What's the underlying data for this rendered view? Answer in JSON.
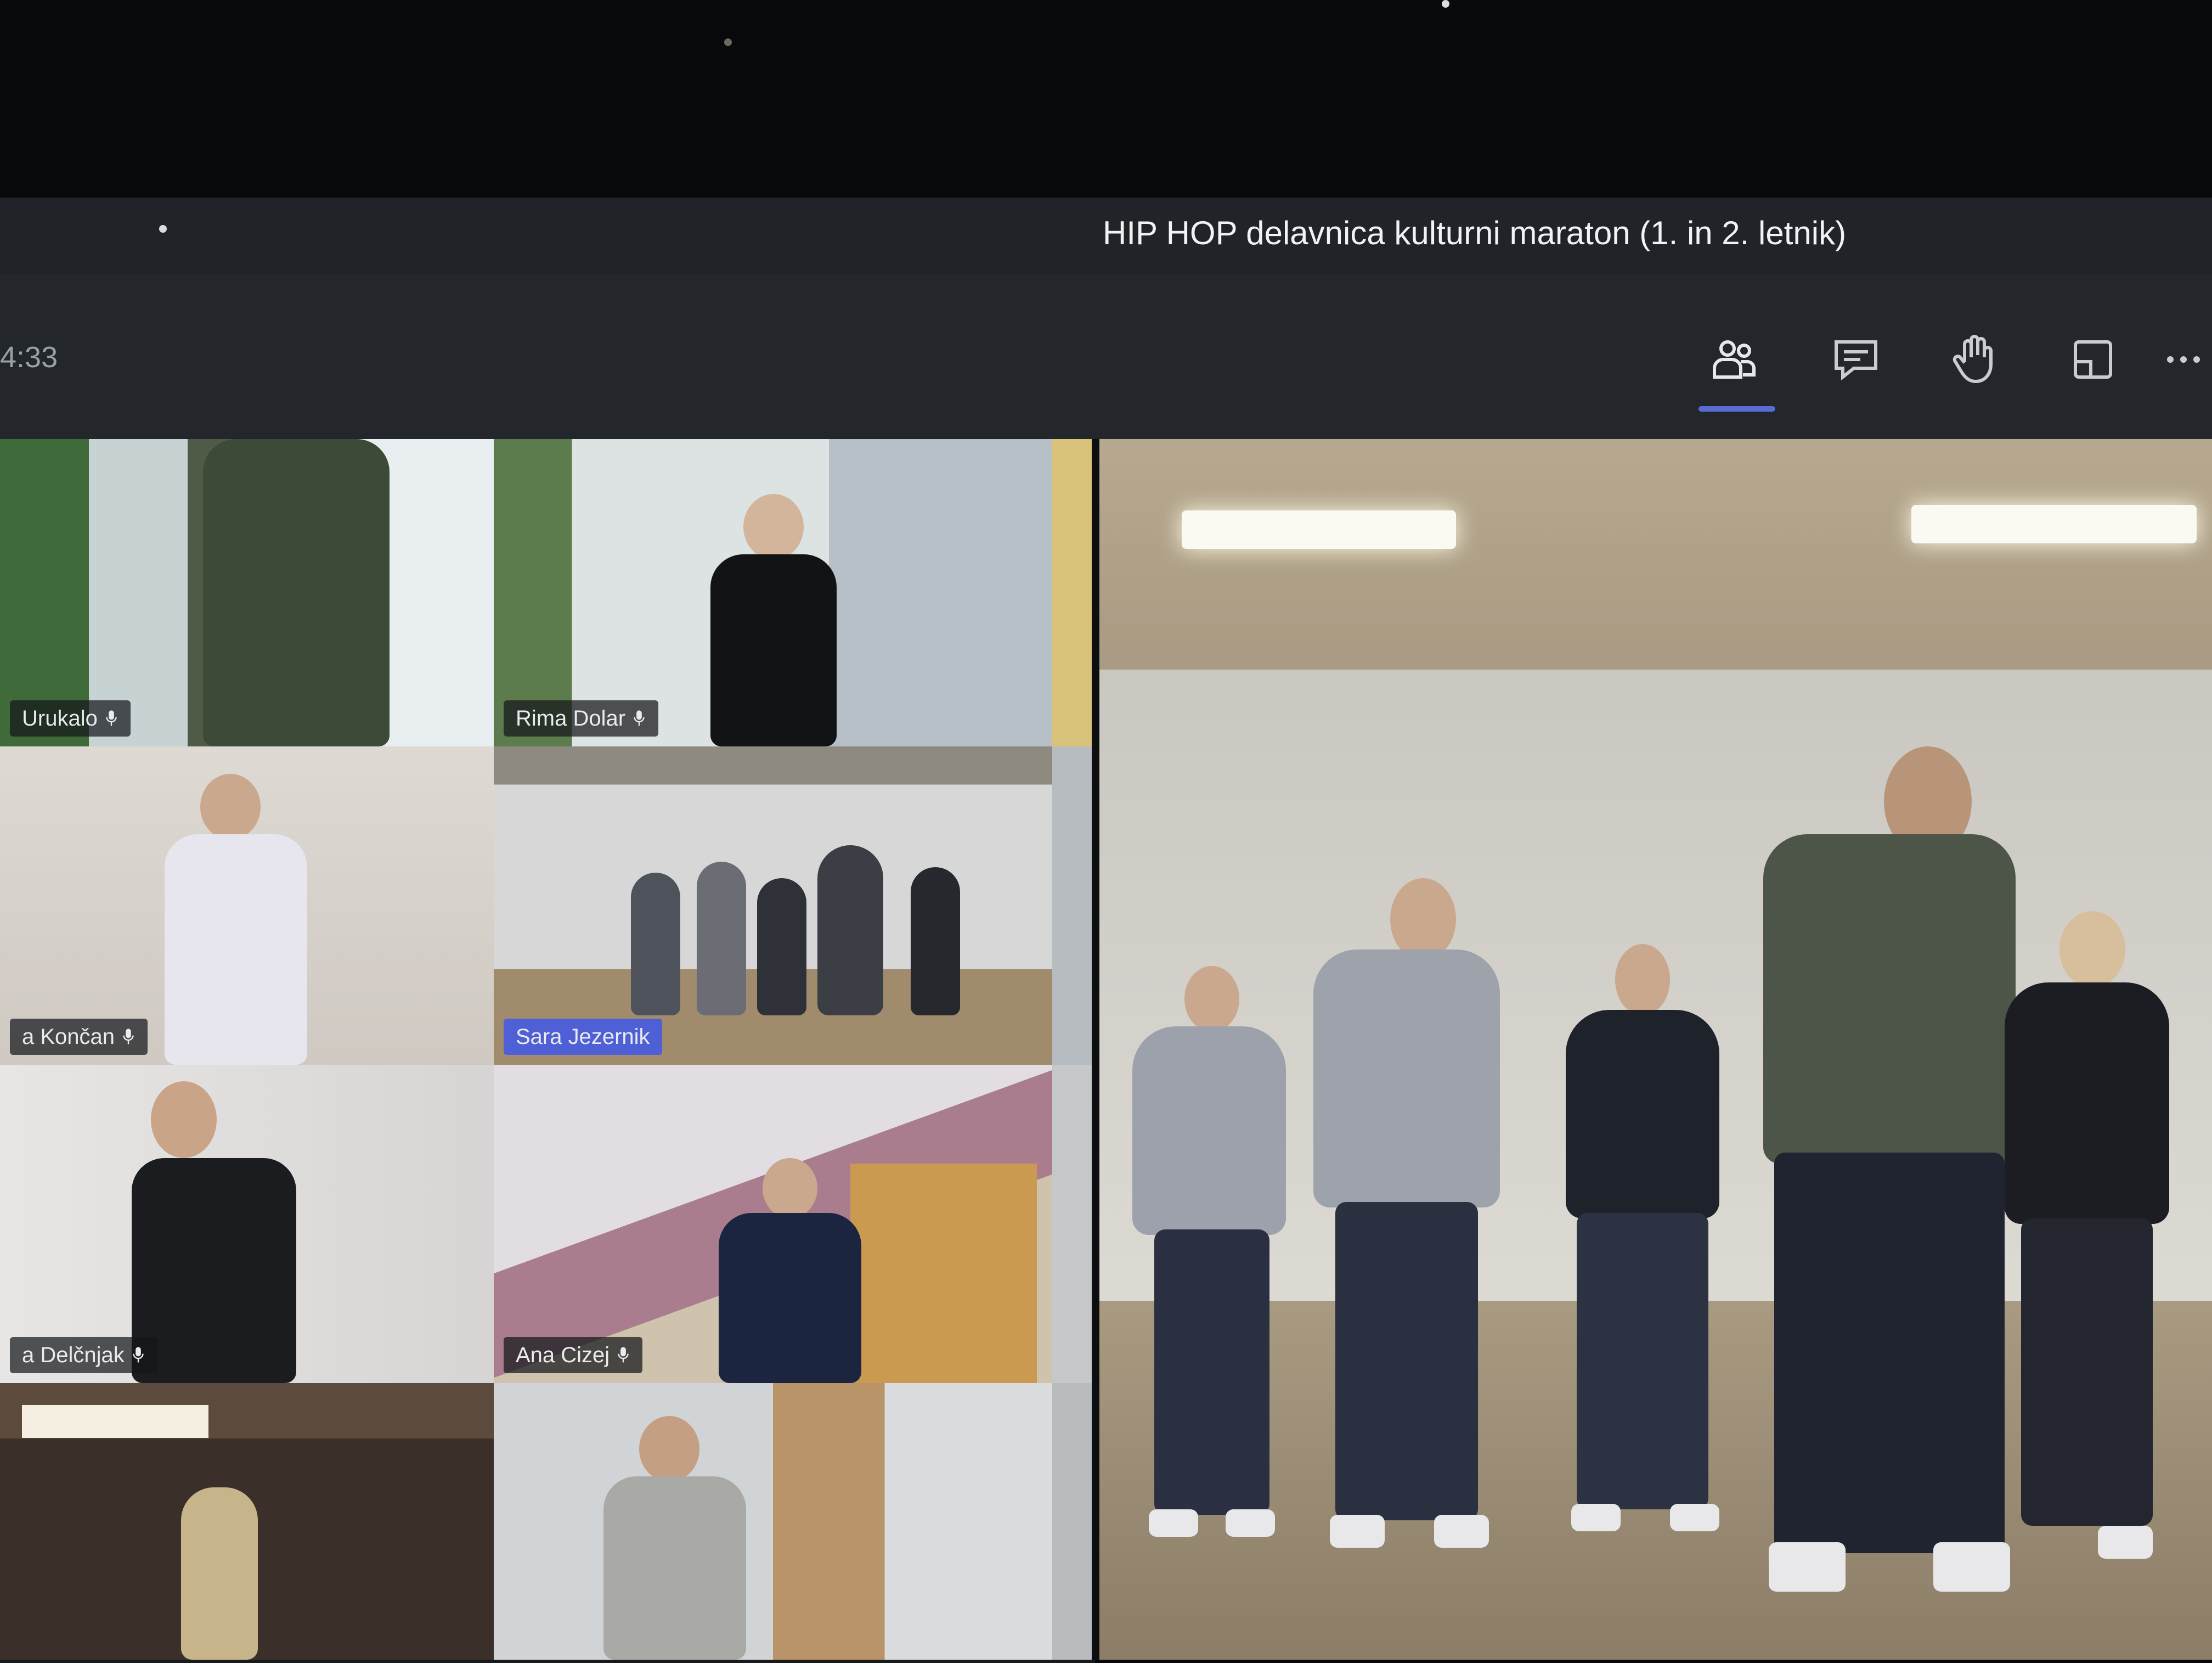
{
  "meeting": {
    "title": "HIP HOP delavnica kulturni maraton (1. in 2. letnik)",
    "elapsed_time": "4:33"
  },
  "toolbar": {
    "buttons": [
      {
        "icon": "people-icon",
        "active": true
      },
      {
        "icon": "chat-icon",
        "active": false
      },
      {
        "icon": "raise-hand-icon",
        "active": false
      },
      {
        "icon": "breakout-rooms-icon",
        "active": false
      },
      {
        "icon": "more-options-icon",
        "active": false
      }
    ],
    "accent_color": "#5b6bd6"
  },
  "participants": [
    {
      "name": "Urukalo",
      "muted": true
    },
    {
      "name": "Rima Dolar",
      "muted": true
    },
    {
      "name": "a Končan",
      "muted": true
    },
    {
      "name": "Sara Jezernik",
      "muted": false,
      "highlighted": true
    },
    {
      "name": "a Delčnjak",
      "muted": true
    },
    {
      "name": "Ana Cizej",
      "muted": true
    },
    {
      "name": "",
      "muted": false
    },
    {
      "name": "",
      "muted": false
    }
  ],
  "spotlight": {
    "dancer_count": 5
  }
}
